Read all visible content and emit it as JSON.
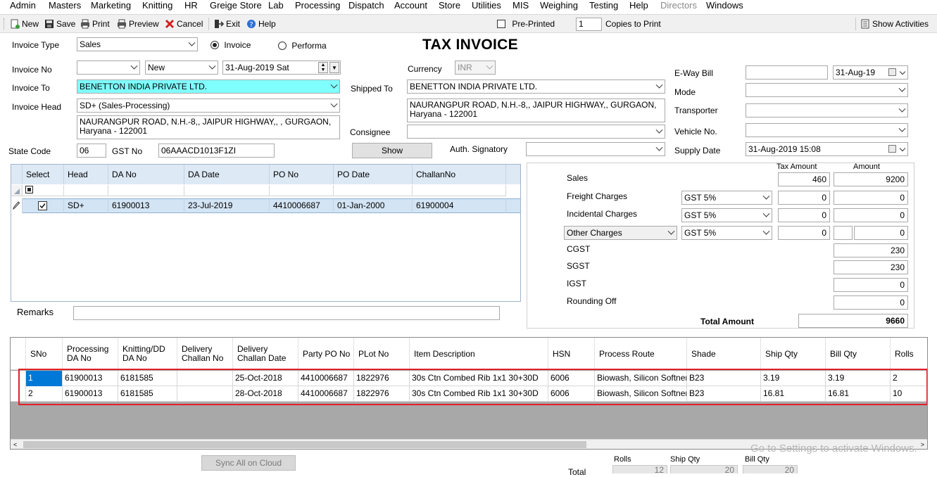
{
  "menu": [
    "Admin",
    "Masters",
    "Marketing",
    "Knitting",
    "HR",
    "Greige Store",
    "Lab",
    "Processing",
    "Dispatch",
    "Account",
    "Store",
    "Utilities",
    "MIS",
    "Weighing",
    "Testing",
    "Help",
    "Directors",
    "Windows"
  ],
  "toolbar": {
    "new": "New",
    "save": "Save",
    "print": "Print",
    "preview": "Preview",
    "cancel": "Cancel",
    "exit": "Exit",
    "help": "Help",
    "preprinted": "Pre-Printed",
    "copies_value": "1",
    "copies_label": "Copies to Print",
    "show_activities": "Show Activities"
  },
  "form": {
    "title": "TAX INVOICE",
    "invoice_type_label": "Invoice Type",
    "invoice_type_value": "Sales",
    "radio_invoice": "Invoice",
    "radio_performa": "Performa",
    "invoice_no_label": "Invoice No",
    "invoice_no_value": "",
    "invoice_status": "New",
    "invoice_date": "31-Aug-2019  Sat",
    "currency_label": "Currency",
    "currency_value": "INR",
    "invoice_to_label": "Invoice To",
    "invoice_to_value": "BENETTON INDIA PRIVATE LTD.",
    "shipped_to_label": "Shipped To",
    "shipped_to_value": "BENETTON INDIA PRIVATE LTD.",
    "invoice_head_label": "Invoice Head",
    "invoice_head_value": "SD+ (Sales-Processing)",
    "invoice_address": "NAURANGPUR ROAD, N.H.-8,, JAIPUR HIGHWAY,, , GURGAON, Haryana - 122001",
    "shipped_address": "NAURANGPUR ROAD, N.H.-8,, JAIPUR HIGHWAY,, GURGAON, Haryana - 122001",
    "consignee_label": "Consignee",
    "consignee_value": "",
    "state_code_label": "State Code",
    "state_code_value": "06",
    "gst_no_label": "GST No",
    "gst_no_value": "06AAACD1013F1ZI",
    "show_button": "Show",
    "auth_signatory_label": "Auth. Signatory",
    "auth_signatory_value": "",
    "eway_bill_label": "E-Way Bill",
    "eway_bill_value": "",
    "eway_date": "31-Aug-19",
    "mode_label": "Mode",
    "mode_value": "",
    "transporter_label": "Transporter",
    "transporter_value": "",
    "vehicle_label": "Vehicle No.",
    "vehicle_value": "",
    "supply_date_label": "Supply Date",
    "supply_date_value": "31-Aug-2019 15:08",
    "remarks_label": "Remarks",
    "remarks_value": ""
  },
  "da_grid": {
    "columns": [
      "Select",
      "Head",
      "DA No",
      "DA Date",
      "PO No",
      "PO Date",
      "ChallanNo"
    ],
    "rows": [
      {
        "head": "SD+",
        "da_no": "61900013",
        "da_date": "23-Jul-2019",
        "po_no": "4410006687",
        "po_date": "01-Jan-2000",
        "challan_no": "61900004"
      }
    ]
  },
  "charges": {
    "tax_amount_header": "Tax Amount",
    "amount_header": "Amount",
    "sales_label": "Sales",
    "sales_tax": "460",
    "sales_amount": "9200",
    "freight_label": "Freight Charges",
    "freight_gst": "GST 5%",
    "freight_tax": "0",
    "freight_amount": "0",
    "incidental_label": "Incidental Charges",
    "incidental_gst": "GST 5%",
    "incidental_tax": "0",
    "incidental_amount": "0",
    "other_label": "Other Charges",
    "other_gst": "GST 5%",
    "other_tax": "0",
    "other_amount": "0",
    "cgst_label": "CGST",
    "cgst_value": "230",
    "sgst_label": "SGST",
    "sgst_value": "230",
    "igst_label": "IGST",
    "igst_value": "0",
    "rounding_label": "Rounding Off",
    "rounding_value": "0",
    "total_label": "Total Amount",
    "total_value": "9660"
  },
  "main_grid": {
    "columns": [
      "SNo",
      "Processing DA No",
      "Knitting/DD DA No",
      "Delivery Challan No",
      "Delivery Challan Date",
      "Party PO No",
      "PLot No",
      "Item Description",
      "HSN",
      "Process Route",
      "Shade",
      "Ship Qty",
      "Bill Qty",
      "Rolls"
    ],
    "rows": [
      {
        "sno": "1",
        "proc_da": "61900013",
        "knit_da": "6181585",
        "dc_no": "",
        "dc_date": "25-Oct-2018",
        "party_po": "4410006687",
        "plot": "1822976",
        "item": "30s Ctn Combed Rib 1x1 30+30D",
        "hsn": "6006",
        "route": "Biowash, Silicon Softner...",
        "shade": "B23",
        "ship_qty": "3.19",
        "bill_qty": "3.19",
        "rolls": "2"
      },
      {
        "sno": "2",
        "proc_da": "61900013",
        "knit_da": "6181585",
        "dc_no": "",
        "dc_date": "28-Oct-2018",
        "party_po": "4410006687",
        "plot": "1822976",
        "item": "30s Ctn Combed Rib 1x1 30+30D",
        "hsn": "6006",
        "route": "Biowash, Silicon Softner...",
        "shade": "B23",
        "ship_qty": "16.81",
        "bill_qty": "16.81",
        "rolls": "10"
      }
    ]
  },
  "footer": {
    "sync_button": "Sync All on Cloud",
    "rolls_label": "Rolls",
    "ship_qty_label": "Ship Qty",
    "bill_qty_label": "Bill Qty",
    "total_label": "Total",
    "total_rolls": "12",
    "total_ship_qty": "20",
    "total_bill_qty": "20"
  },
  "watermark": "Go to Settings to activate Windows.",
  "colors": {
    "highlight": "#80ffff",
    "selection": "#0078d7",
    "red_border": "#e0202a",
    "grid_header": "#dde9f5"
  }
}
